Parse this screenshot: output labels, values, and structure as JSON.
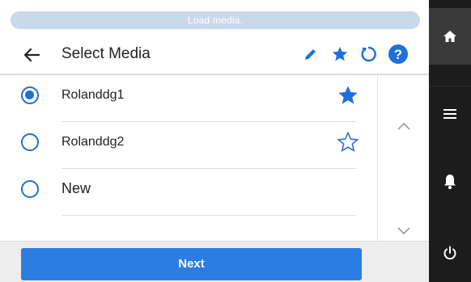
{
  "status": {
    "message": "Load media."
  },
  "header": {
    "title": "Select Media"
  },
  "media_list": [
    {
      "label": "Rolanddg1",
      "selected": true,
      "favorite": true
    },
    {
      "label": "Rolanddg2",
      "selected": false,
      "favorite": false
    },
    {
      "label": "New",
      "selected": false,
      "favorite": null
    }
  ],
  "footer": {
    "next_label": "Next"
  },
  "colors": {
    "accent": "#1f6fd8",
    "button": "#2b7de3",
    "status_pill": "#c9d9ec",
    "sidebar": "#1c1c1c"
  },
  "icons": {
    "header": [
      "back-arrow-icon",
      "pencil-icon",
      "star-icon",
      "refresh-icon",
      "help-icon"
    ],
    "sidebar": [
      "home-icon",
      "menu-icon",
      "bell-icon",
      "power-icon"
    ],
    "scroll": [
      "chevron-up-icon",
      "chevron-down-icon"
    ]
  }
}
